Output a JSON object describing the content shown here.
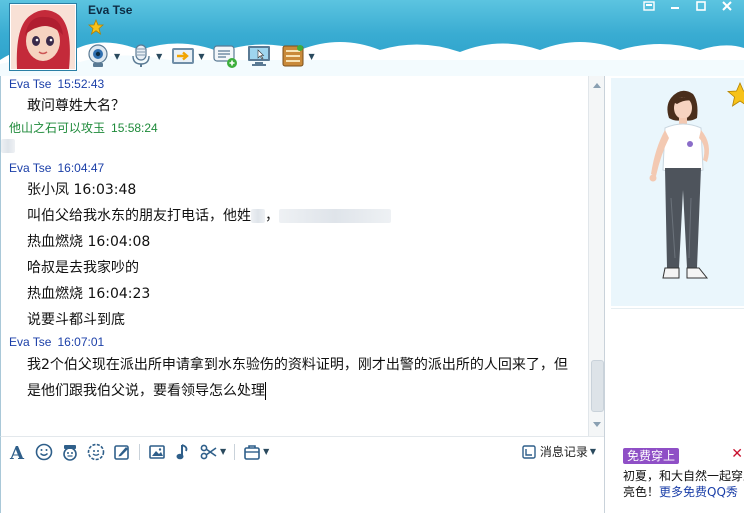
{
  "header": {
    "contact_name": "Eva Tse",
    "toolbar_icons": [
      "video-call-icon",
      "voice-call-icon",
      "file-transfer-icon",
      "multi-chat-icon",
      "remote-assist-icon",
      "apps-icon"
    ],
    "window_controls": [
      "skin-icon",
      "minimize-icon",
      "maximize-icon",
      "close-icon"
    ]
  },
  "messages": [
    {
      "sender": "Eva Tse",
      "time": "15:52:43",
      "color": "#1b3fa8",
      "lines": [
        "敢问尊姓大名？"
      ]
    },
    {
      "sender": "他山之石可以攻玉",
      "time": "15:58:24",
      "color": "#1e8a3a",
      "lines": [
        ""
      ]
    },
    {
      "sender": "Eva Tse",
      "time": "16:04:47",
      "color": "#1b3fa8",
      "lines": [
        "张小凤  16:03:48",
        "叫伯父给我水东的朋友打电话，他姓",
        "热血燃烧  16:04:08",
        "哈叔是去我家吵的",
        "热血燃烧  16:04:23",
        "说要斗都斗到底"
      ]
    },
    {
      "sender": "Eva Tse",
      "time": "16:07:01",
      "color": "#1b3fa8",
      "lines": [
        "我2个伯父现在派出所申请拿到水东验伤的资料证明，刚才出警的派出所的人回来了，但是他们跟我伯父说，要看领导怎么处理"
      ]
    }
  ],
  "redacted_suffix": "，",
  "input_toolbar": {
    "icons": [
      "font-icon",
      "emoji-icon",
      "magic-emoji-icon",
      "graffiti-icon",
      "edit-icon",
      "image-icon",
      "music-icon",
      "screenshot-scissors-icon",
      "toolbox-icon"
    ],
    "history_label": "消息记录"
  },
  "ad": {
    "badge": "免费穿上",
    "line1": "初夏，和大自然一起穿上",
    "line2_prefix": "亮色！",
    "line2_link": "更多免费QQ秀",
    "close": "✕"
  }
}
